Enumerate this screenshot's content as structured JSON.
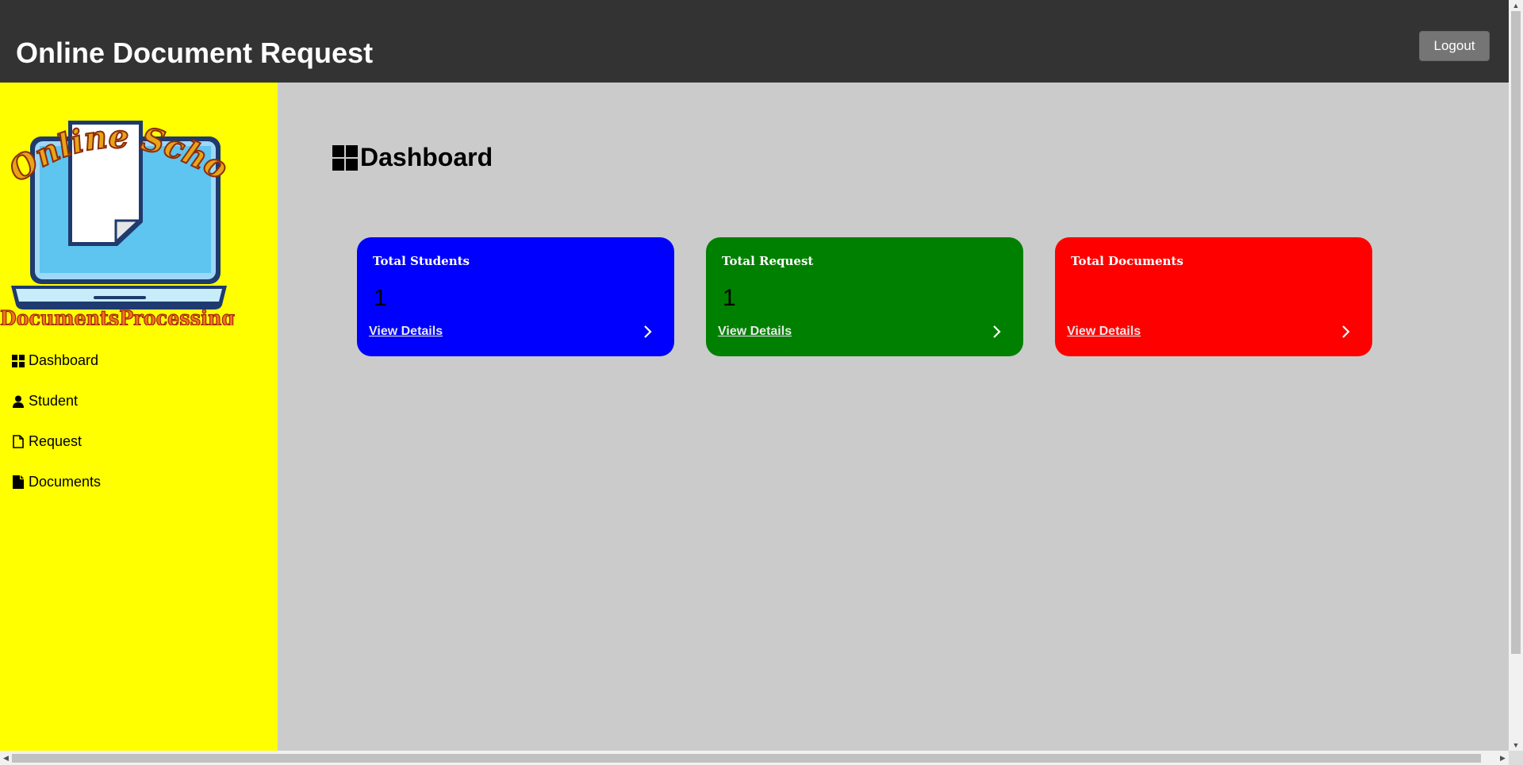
{
  "header": {
    "title": "Online Document Request",
    "logout_label": "Logout"
  },
  "sidebar": {
    "logo": {
      "top_text": "Online School",
      "bottom_text": "DocumentsProcessing"
    },
    "items": [
      {
        "label": "Dashboard",
        "icon": "dashboard-grid-icon"
      },
      {
        "label": "Student",
        "icon": "user-icon"
      },
      {
        "label": "Request",
        "icon": "file-outline-icon"
      },
      {
        "label": "Documents",
        "icon": "file-icon"
      }
    ]
  },
  "main": {
    "page_title": "Dashboard",
    "cards": [
      {
        "title": "Total Students",
        "value": "1",
        "link": "View Details",
        "color": "#0000ff"
      },
      {
        "title": "Total Request",
        "value": "1",
        "link": "View Details",
        "color": "#008000"
      },
      {
        "title": "Total Documents",
        "value": "",
        "link": "View Details",
        "color": "#ff0000"
      }
    ]
  },
  "colors": {
    "topbar": "#333333",
    "sidebar": "#ffff00",
    "main_bg": "#cbcbcb"
  }
}
